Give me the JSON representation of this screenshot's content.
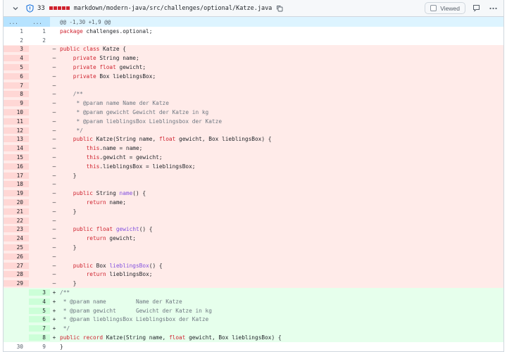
{
  "header": {
    "count": "33",
    "diffstat": [
      "#cf222e",
      "#cf222e",
      "#cf222e",
      "#cf222e",
      "#cf222e"
    ],
    "path": "markdown/modern-java/src/challenges/optional/Katze.java",
    "viewed_label": "Viewed"
  },
  "hunk": {
    "g1": "...",
    "g2": "...",
    "text": "@@ -1,30 +1,9 @@"
  },
  "colors": {
    "deletion_bg": "#ffebe9",
    "addition_bg": "#e6ffec",
    "keyword": "#cf222e",
    "method": "#8250df"
  },
  "lines": [
    {
      "type": "ctx",
      "o": "1",
      "n": "1",
      "m": "",
      "t": "package challenges.optional;"
    },
    {
      "type": "ctx",
      "o": "2",
      "n": "2",
      "m": "",
      "t": ""
    },
    {
      "type": "del",
      "o": "3",
      "n": "",
      "m": "–",
      "t": "public class Katze {"
    },
    {
      "type": "del",
      "o": "4",
      "n": "",
      "m": "–",
      "t": "    private String name;"
    },
    {
      "type": "del",
      "o": "5",
      "n": "",
      "m": "–",
      "t": "    private float gewicht;"
    },
    {
      "type": "del",
      "o": "6",
      "n": "",
      "m": "–",
      "t": "    private Box lieblingsBox;"
    },
    {
      "type": "del",
      "o": "7",
      "n": "",
      "m": "–",
      "t": ""
    },
    {
      "type": "del",
      "o": "8",
      "n": "",
      "m": "–",
      "t": "    /**"
    },
    {
      "type": "del",
      "o": "9",
      "n": "",
      "m": "–",
      "t": "     * @param name Name der Katze"
    },
    {
      "type": "del",
      "o": "10",
      "n": "",
      "m": "–",
      "t": "     * @param gewicht Gewicht der Katze in kg"
    },
    {
      "type": "del",
      "o": "11",
      "n": "",
      "m": "–",
      "t": "     * @param lieblingsBox Lieblingsbox der Katze"
    },
    {
      "type": "del",
      "o": "12",
      "n": "",
      "m": "–",
      "t": "     */"
    },
    {
      "type": "del",
      "o": "13",
      "n": "",
      "m": "–",
      "t": "    public Katze(String name, float gewicht, Box lieblingsBox) {"
    },
    {
      "type": "del",
      "o": "14",
      "n": "",
      "m": "–",
      "t": "        this.name = name;"
    },
    {
      "type": "del",
      "o": "15",
      "n": "",
      "m": "–",
      "t": "        this.gewicht = gewicht;"
    },
    {
      "type": "del",
      "o": "16",
      "n": "",
      "m": "–",
      "t": "        this.lieblingsBox = lieblingsBox;"
    },
    {
      "type": "del",
      "o": "17",
      "n": "",
      "m": "–",
      "t": "    }"
    },
    {
      "type": "del",
      "o": "18",
      "n": "",
      "m": "–",
      "t": ""
    },
    {
      "type": "del",
      "o": "19",
      "n": "",
      "m": "–",
      "t": "    public String name() {"
    },
    {
      "type": "del",
      "o": "20",
      "n": "",
      "m": "–",
      "t": "        return name;"
    },
    {
      "type": "del",
      "o": "21",
      "n": "",
      "m": "–",
      "t": "    }"
    },
    {
      "type": "del",
      "o": "22",
      "n": "",
      "m": "–",
      "t": ""
    },
    {
      "type": "del",
      "o": "23",
      "n": "",
      "m": "–",
      "t": "    public float gewicht() {"
    },
    {
      "type": "del",
      "o": "24",
      "n": "",
      "m": "–",
      "t": "        return gewicht;"
    },
    {
      "type": "del",
      "o": "25",
      "n": "",
      "m": "–",
      "t": "    }"
    },
    {
      "type": "del",
      "o": "26",
      "n": "",
      "m": "–",
      "t": ""
    },
    {
      "type": "del",
      "o": "27",
      "n": "",
      "m": "–",
      "t": "    public Box lieblingsBox() {"
    },
    {
      "type": "del",
      "o": "28",
      "n": "",
      "m": "–",
      "t": "        return lieblingsBox;"
    },
    {
      "type": "del",
      "o": "29",
      "n": "",
      "m": "–",
      "t": "    }"
    },
    {
      "type": "add",
      "o": "",
      "n": "3",
      "m": "+",
      "t": "/**"
    },
    {
      "type": "add",
      "o": "",
      "n": "4",
      "m": "+",
      "t": " * @param name         Name der Katze"
    },
    {
      "type": "add",
      "o": "",
      "n": "5",
      "m": "+",
      "t": " * @param gewicht      Gewicht der Katze in kg"
    },
    {
      "type": "add",
      "o": "",
      "n": "6",
      "m": "+",
      "t": " * @param lieblingsBox Lieblingsbox der Katze"
    },
    {
      "type": "add",
      "o": "",
      "n": "7",
      "m": "+",
      "t": " */"
    },
    {
      "type": "add",
      "o": "",
      "n": "8",
      "m": "+",
      "t": "public record Katze(String name, float gewicht, Box lieblingsBox) {"
    },
    {
      "type": "tail",
      "o": "30",
      "n": "9",
      "m": "",
      "t": "}"
    }
  ]
}
